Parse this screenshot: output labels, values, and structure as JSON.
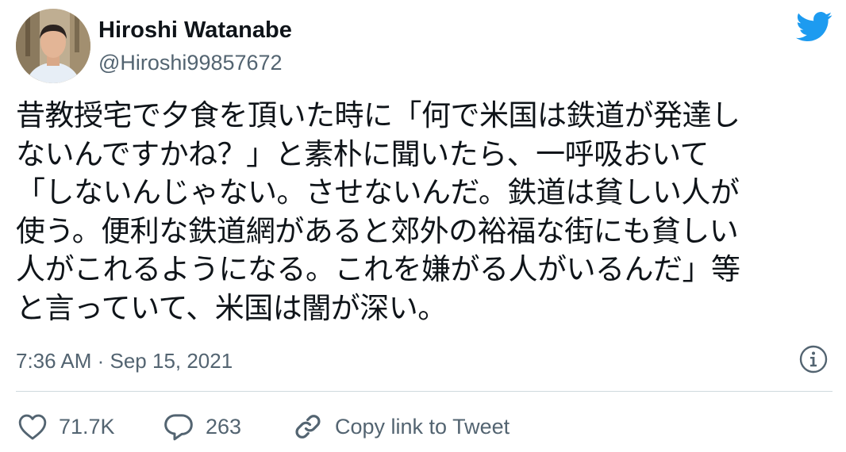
{
  "user": {
    "display_name": "Hiroshi Watanabe",
    "handle": "@Hiroshi99857672",
    "avatar_icon": "profile-photo"
  },
  "brand": {
    "icon": "twitter-bird-icon",
    "color": "#1d9bf0"
  },
  "tweet": {
    "lines": [
      "昔教授宅で夕食を頂いた時に「何で米国は鉄道が発達し",
      "ないんですかね？」と素朴に聞いたら、一呼吸おいて",
      "「しないんじゃない。させないんだ。鉄道は貧しい人が",
      "使う。便利な鉄道網があると郊外の裕福な街にも貧しい",
      "人がこれるようになる。これを嫌がる人がいるんだ」等",
      "と言っていて、米国は闇が深い。"
    ],
    "timestamp": "7:36 AM · Sep 15, 2021"
  },
  "actions": {
    "like_count": "71.7K",
    "reply_count": "263",
    "copy_label": "Copy link to Tweet"
  },
  "colors": {
    "text": "#0f1419",
    "muted": "#536471",
    "divider": "#cfd9de"
  }
}
